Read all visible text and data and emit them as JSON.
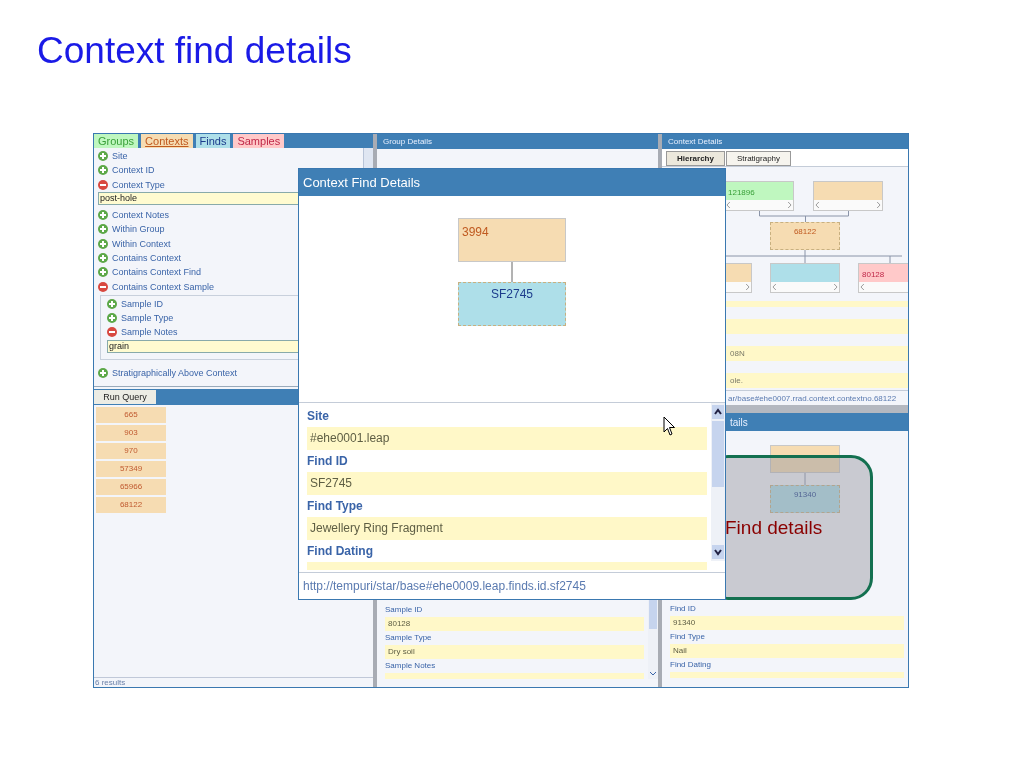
{
  "slide_title": "Context find details",
  "query_panel": {
    "tabs": [
      {
        "label": "Groups",
        "kind": "group",
        "selected": false
      },
      {
        "label": "Contexts",
        "kind": "context",
        "selected": true
      },
      {
        "label": "Finds",
        "kind": "find",
        "selected": false
      },
      {
        "label": "Samples",
        "kind": "sample",
        "selected": false
      }
    ],
    "tree": [
      {
        "label": "Site",
        "expanded": false
      },
      {
        "label": "Context ID",
        "expanded": false
      },
      {
        "label": "Context Type",
        "expanded": true,
        "value": "post-hole"
      },
      {
        "label": "Context Notes",
        "expanded": false
      },
      {
        "label": "Within Group",
        "expanded": false
      },
      {
        "label": "Within Context",
        "expanded": false
      },
      {
        "label": "Contains Context",
        "expanded": false
      },
      {
        "label": "Contains Context Find",
        "expanded": false
      },
      {
        "label": "Contains Context Sample",
        "expanded": true,
        "children": [
          {
            "label": "Sample ID",
            "expanded": false
          },
          {
            "label": "Sample Type",
            "expanded": false
          },
          {
            "label": "Sample Notes",
            "expanded": true,
            "value": "grain"
          }
        ]
      },
      {
        "label": "Stratigraphically Above Context",
        "expanded": false
      }
    ],
    "run_button": "Run Query",
    "results": [
      "665",
      "903",
      "970",
      "57349",
      "65966",
      "68122"
    ],
    "result_count": "6 results"
  },
  "group_details": {
    "title": "Group Details",
    "fields": [
      {
        "label": "Sample ID",
        "value": "80128"
      },
      {
        "label": "Sample Type",
        "value": "Dry soil"
      },
      {
        "label": "Sample Notes"
      }
    ]
  },
  "context_details": {
    "title": "Context Details",
    "tabs": [
      {
        "label": "Hierarchy",
        "selected": true
      },
      {
        "label": "Stratigraphy",
        "selected": false
      }
    ],
    "hierarchy": {
      "parents": [
        {
          "label": "121896",
          "kind": "group",
          "current": false
        },
        {
          "kind": "context",
          "current": false
        }
      ],
      "node": {
        "label": "68122",
        "kind": "context",
        "current": true
      },
      "children": [
        {
          "kind": "context",
          "current": false
        },
        {
          "kind": "find",
          "current": false
        },
        {
          "label": "80128",
          "kind": "sample",
          "current": false
        }
      ]
    },
    "rows": [
      {
        "value": "08N"
      },
      {
        "value": "ole."
      }
    ],
    "uri": "ar/base#ehe0007.rrad.context.contextno.68122"
  },
  "find_details": {
    "title": "tails",
    "hierarchy": {
      "parent": {
        "kind": "context",
        "current": false
      },
      "node": {
        "label": "91340",
        "kind": "find",
        "current": true
      }
    },
    "fields": [
      {
        "label": "Find ID",
        "value": "91340"
      },
      {
        "label": "Find Type",
        "value": "Nail"
      },
      {
        "label": "Find Dating"
      }
    ]
  },
  "dialog": {
    "title": "Context Find Details",
    "parent": {
      "label": "3994",
      "kind": "context",
      "current": false
    },
    "node": {
      "label": "SF2745",
      "kind": "find",
      "current": true
    },
    "fields": [
      {
        "label": "Site",
        "value": "#ehe0001.leap"
      },
      {
        "label": "Find ID",
        "value": "SF2745"
      },
      {
        "label": "Find Type",
        "value": "Jewellery Ring Fragment"
      },
      {
        "label": "Find Dating"
      }
    ],
    "uri": "http://tempuri/star/base#ehe0009.leap.finds.id.sf2745"
  },
  "callout": {
    "text": "Find details"
  }
}
